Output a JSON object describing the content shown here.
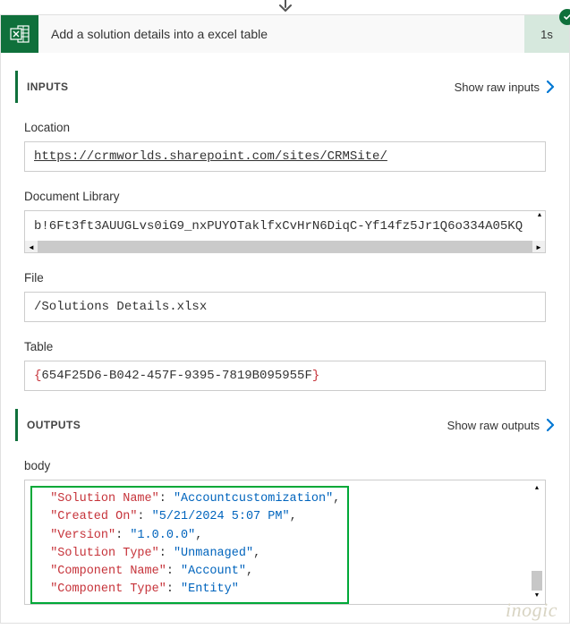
{
  "header": {
    "title": "Add a solution details into a excel table",
    "duration": "1s"
  },
  "inputs": {
    "section_title": "INPUTS",
    "show_raw_label": "Show raw inputs",
    "fields": {
      "location": {
        "label": "Location",
        "value": "https://crmworlds.sharepoint.com/sites/CRMSite/"
      },
      "document_library": {
        "label": "Document Library",
        "value": "b!6Ft3ft3AUUGLvs0iG9_nxPUYOTaklfxCvHrN6DiqC-Yf14fz5Jr1Q6o334A05KQ"
      },
      "file": {
        "label": "File",
        "value": "/Solutions Details.xlsx"
      },
      "table": {
        "label": "Table",
        "value": "654F25D6-B042-457F-9395-7819B095955F"
      }
    }
  },
  "outputs": {
    "section_title": "OUTPUTS",
    "show_raw_label": "Show raw outputs",
    "body_label": "body",
    "json": {
      "solution_name_key": "\"Solution Name\"",
      "solution_name_val": "\"Accountcustomization\"",
      "created_on_key": "\"Created On\"",
      "created_on_val": "\"5/21/2024 5:07 PM\"",
      "version_key": "\"Version\"",
      "version_val": "\"1.0.0.0\"",
      "solution_type_key": "\"Solution Type\"",
      "solution_type_val": "\"Unmanaged\"",
      "component_name_key": "\"Component Name\"",
      "component_name_val": "\"Account\"",
      "component_type_key": "\"Component Type\"",
      "component_type_val": "\"Entity\""
    }
  },
  "watermark": "inogic"
}
